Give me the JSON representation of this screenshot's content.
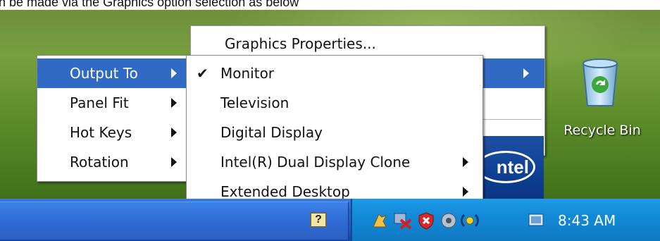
{
  "caption": "n be made via the Graphics option selection as below",
  "desktop": {
    "recycle_bin_label": "Recycle Bin",
    "intel_logo_text": "ntel"
  },
  "taskbar": {
    "clock": "8:43 AM",
    "help_icon_text": "?"
  },
  "context_menu": {
    "items": [
      {
        "label": "Graphics Properties..."
      }
    ]
  },
  "graphics_options_menu": {
    "items": [
      {
        "label": "Output To",
        "has_submenu": true,
        "highlighted": true
      },
      {
        "label": "Panel Fit",
        "has_submenu": true
      },
      {
        "label": "Hot Keys",
        "has_submenu": true
      },
      {
        "label": "Rotation",
        "has_submenu": true
      }
    ]
  },
  "output_to_menu": {
    "items": [
      {
        "label": "Monitor",
        "checked": true
      },
      {
        "label": "Television"
      },
      {
        "label": "Digital Display"
      },
      {
        "label": "Intel(R) Dual Display Clone",
        "has_submenu": true
      },
      {
        "label": "Extended Desktop",
        "has_submenu": true
      }
    ]
  },
  "colors": {
    "highlight": "#316ac5",
    "taskbar_blue": "#2455b8",
    "tray_blue": "#138ad7"
  }
}
